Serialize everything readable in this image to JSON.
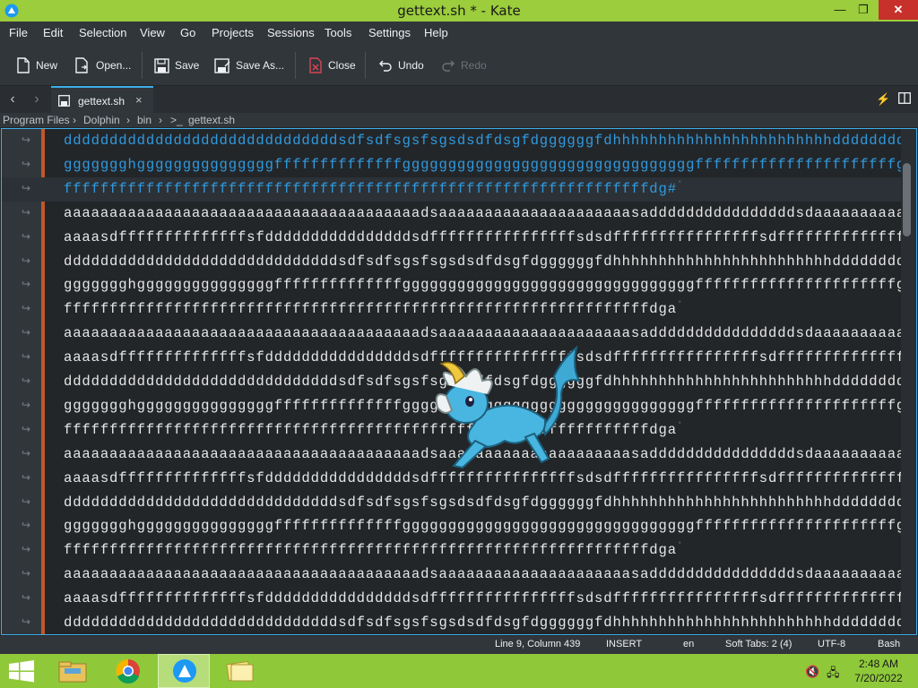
{
  "window": {
    "title": "gettext.sh * - Kate",
    "controls": {
      "minimize": "—",
      "maximize": "❐",
      "close": "✕"
    }
  },
  "menu": [
    "File",
    "Edit",
    "Selection",
    "View",
    "Go",
    "Projects",
    "Sessions",
    "Tools",
    "Settings",
    "Help"
  ],
  "toolbar": {
    "new": "New",
    "open": "Open...",
    "save": "Save",
    "save_as": "Save As...",
    "close": "Close",
    "undo": "Undo",
    "redo": "Redo"
  },
  "tab": {
    "label": "gettext.sh",
    "close": "×"
  },
  "breadcrumb": [
    "Program Files",
    "Dolphin",
    "bin",
    "gettext.sh"
  ],
  "editor": {
    "lines": [
      {
        "text": "ddddddddddddddddddddddddddddddsdfsdfsgsfsgsdsdfdsgfdggggggfdhhhhhhhhhhhhhhhhhhhhhhhhdddddddddddgghgg",
        "selected": true,
        "eol": false
      },
      {
        "text": "ggggggghgggggggggggggggffffffffffffffggggggggggggggggggggggggggggggggffffffffffffffffffffffgffff",
        "selected": true,
        "eol": false
      },
      {
        "text": "ffffffffffffffffffffffffffffffffffffffffffffffffffffffffffffffffdg#",
        "selected": true,
        "eol": true,
        "current": true
      },
      {
        "text": "aaaaaaaaaaaaaaaaaaaaaaaaaaaaaaaaaaaaaaadsaaaaaaaaaaaaaaaaaaaaasaddddddddddddddddsdaaaaaaaaaaa",
        "selected": false,
        "eol": false
      },
      {
        "text": "aaaasdffffffffffffffsfddddddddddddddddsdffffffffffffffffsdsdffffffffffffffffsdffffffffffffffsddd",
        "selected": false,
        "eol": false
      },
      {
        "text": "ddddddddddddddddddddddddddddddsdfsdfsgsfsgsdsdfdsgfdggggggfdhhhhhhhhhhhhhhhhhhhhhhhhdddddddddddgghgg",
        "selected": false,
        "eol": false
      },
      {
        "text": "ggggggghgggggggggggggggffffffffffffffggggggggggggggggggggggggggggggggffffffffffffffffffffffgffff",
        "selected": false,
        "eol": false
      },
      {
        "text": "ffffffffffffffffffffffffffffffffffffffffffffffffffffffffffffffffdga",
        "selected": false,
        "eol": true
      },
      {
        "text": "aaaaaaaaaaaaaaaaaaaaaaaaaaaaaaaaaaaaaaadsaaaaaaaaaaaaaaaaaaaaasaddddddddddddddddsdaaaaaaaaaaa",
        "selected": false,
        "eol": false
      },
      {
        "text": "aaaasdffffffffffffffsfddddddddddddddddsdffffffffffffffffsdsdffffffffffffffffsdffffffffffffffsddd",
        "selected": false,
        "eol": false
      },
      {
        "text": "ddddddddddddddddddddddddddddddsdfsdfsgsfsgsdsdfdsgfdggggggfdhhhhhhhhhhhhhhhhhhhhhhhhdddddddddddgghgg",
        "selected": false,
        "eol": false
      },
      {
        "text": "ggggggghgggggggggggggggffffffffffffffggggggggggggggggggggggggggggggggffffffffffffffffffffffgffff",
        "selected": false,
        "eol": false
      },
      {
        "text": "ffffffffffffffffffffffffffffffffffffffffffffffffffffffffffffffffdga",
        "selected": false,
        "eol": true
      },
      {
        "text": "aaaaaaaaaaaaaaaaaaaaaaaaaaaaaaaaaaaaaaadsaaaaaaaaaaaaaaaaaaaaasaddddddddddddddddsdaaaaaaaaaaa",
        "selected": false,
        "eol": false
      },
      {
        "text": "aaaasdffffffffffffffsfddddddddddddddddsdffffffffffffffffsdsdffffffffffffffffsdffffffffffffffsddd",
        "selected": false,
        "eol": false
      },
      {
        "text": "ddddddddddddddddddddddddddddddsdfsdfsgsfsgsdsdfdsgfdggggggfdhhhhhhhhhhhhhhhhhhhhhhhhdddddddddddgghgg",
        "selected": false,
        "eol": false
      },
      {
        "text": "ggggggghgggggggggggggggffffffffffffffggggggggggggggggggggggggggggggggffffffffffffffffffffffgffff",
        "selected": false,
        "eol": false
      },
      {
        "text": "ffffffffffffffffffffffffffffffffffffffffffffffffffffffffffffffffdga",
        "selected": false,
        "eol": true
      },
      {
        "text": "aaaaaaaaaaaaaaaaaaaaaaaaaaaaaaaaaaaaaaadsaaaaaaaaaaaaaaaaaaaaasaddddddddddddddddsdaaaaaaaaaaa",
        "selected": false,
        "eol": false
      },
      {
        "text": "aaaasdffffffffffffffsfddddddddddddddddsdffffffffffffffffsdsdffffffffffffffffsdffffffffffffffsddd",
        "selected": false,
        "eol": false
      },
      {
        "text": "ddddddddddddddddddddddddddddddsdfsdfsgsfsgsdsdfdsgfdggggggfdhhhhhhhhhhhhhhhhhhhhhhhhdddddddddddgghgg",
        "selected": false,
        "eol": false
      }
    ],
    "wrap_marker": "↪",
    "eol_marker": "˚"
  },
  "status": {
    "position": "Line 9, Column 439",
    "mode": "INSERT",
    "language": "en",
    "indent": "Soft Tabs: 2 (4)",
    "encoding": "UTF-8",
    "syntax": "Bash"
  },
  "taskbar": {
    "time": "2:48 AM",
    "date": "7/20/2022"
  },
  "colors": {
    "accent": "#3daee9",
    "selection_text": "#2f9ae0",
    "title_bar": "#9bcd3c",
    "taskbar": "#8fc93a",
    "modified_bar": "#c0562a"
  }
}
